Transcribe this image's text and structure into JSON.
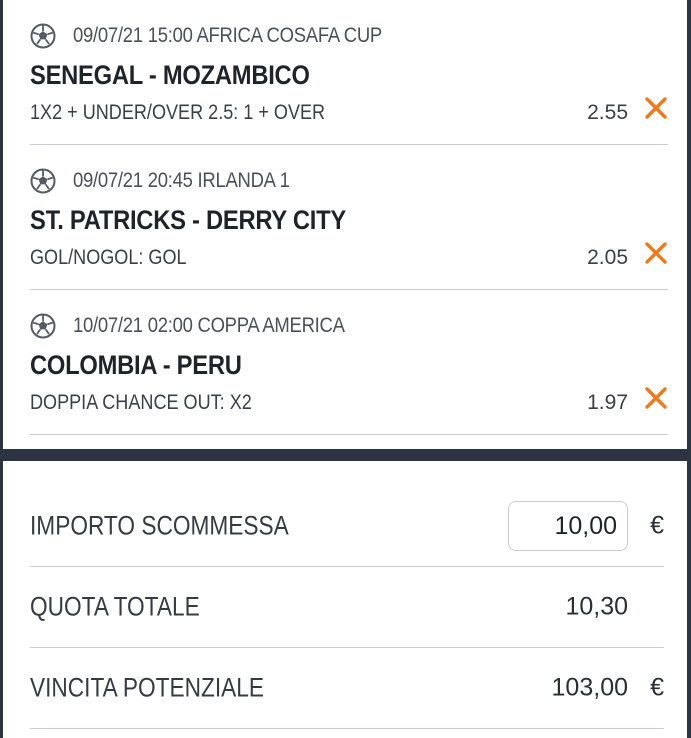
{
  "bets": [
    {
      "date_event": "09/07/21 15:00 AFRICA COSAFA CUP",
      "match": "SENEGAL - MOZAMBICO",
      "market": "1X2 + UNDER/OVER 2.5: 1 + OVER",
      "odd": "2.55",
      "icon": "soccer-ball-icon",
      "remove_icon": "close-icon"
    },
    {
      "date_event": "09/07/21 20:45 IRLANDA 1",
      "match": "ST. PATRICKS - DERRY CITY",
      "market": "GOL/NOGOL: GOL",
      "odd": "2.05",
      "icon": "soccer-ball-icon",
      "remove_icon": "close-icon"
    },
    {
      "date_event": "10/07/21 02:00 COPPA AMERICA",
      "match": "COLOMBIA - PERU",
      "market": "DOPPIA CHANCE OUT: X2",
      "odd": "1.97",
      "icon": "soccer-ball-icon",
      "remove_icon": "close-icon"
    }
  ],
  "summary": {
    "stake_label": "IMPORTO SCOMMESSA",
    "stake_value": "10,00",
    "stake_currency": "€",
    "total_odds_label": "QUOTA TOTALE",
    "total_odds_value": "10,30",
    "potential_win_label": "VINCITA POTENZIALE",
    "potential_win_value": "103,00",
    "potential_win_currency": "€"
  },
  "colors": {
    "background_dark": "#2b3440",
    "remove_orange": "#f07a1a",
    "divider": "#c9ccd0"
  }
}
